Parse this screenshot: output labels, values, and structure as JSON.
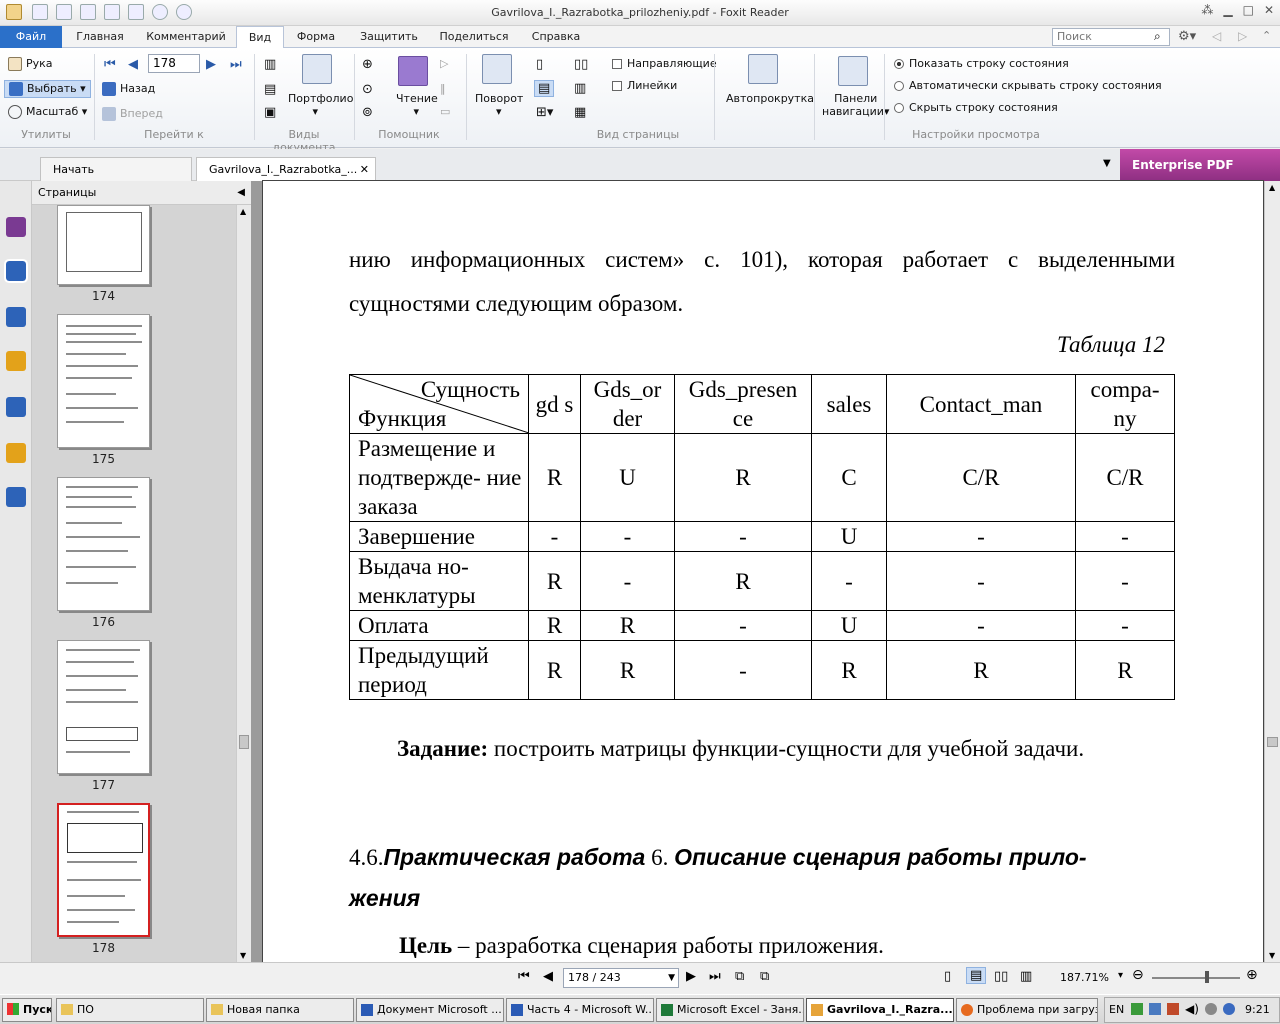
{
  "window": {
    "title": "Gavrilova_I._Razrabotka_prilozheniy.pdf - Foxit Reader"
  },
  "ribbon_tabs": [
    "Файл",
    "Главная",
    "Комментарий",
    "Вид",
    "Форма",
    "Защитить",
    "Поделиться",
    "Справка"
  ],
  "search": {
    "placeholder": "Поиск"
  },
  "ribbon": {
    "tools": {
      "hand": "Рука",
      "select": "Выбрать",
      "zoom": "Масштаб",
      "group": "Утилиты"
    },
    "goto": {
      "page_value": "178",
      "back": "Назад",
      "forward": "Вперед",
      "group": "Перейти к"
    },
    "docviews": {
      "portfolio": "Портфолио",
      "group": "Виды документа"
    },
    "assistant": {
      "reading": "Чтение",
      "group": "Помощник"
    },
    "rotate": {
      "label": "Поворот"
    },
    "pageview": {
      "guides": "Направляющие",
      "rulers": "Линейки",
      "group": "Вид страницы"
    },
    "autoscroll": {
      "label": "Автопрокрутка"
    },
    "navpanels": {
      "label_line1": "Панели",
      "label_line2": "навигации"
    },
    "viewsettings": {
      "opt1": "Показать строку состояния",
      "opt2": "Автоматически скрывать строку состояния",
      "opt3": "Скрыть строку состояния",
      "group": "Настройки просмотра"
    }
  },
  "doc_tabs": {
    "start": "Начать",
    "current": "Gavrilova_I._Razrabotka_...",
    "promo": "Enterprise PDF Reader"
  },
  "pages_panel": {
    "title": "Страницы",
    "thumbs": [
      "174",
      "175",
      "176",
      "177",
      "178"
    ]
  },
  "document": {
    "line1": "нию информационных систем» с. 101), которая работает с выделенными",
    "line2": "сущностями следующим образом.",
    "table_caption": "Таблица 12",
    "table": {
      "header_entity": "Сущность",
      "header_function": "Функция",
      "columns": [
        "gd s",
        "Gds_or der",
        "Gds_presen ce",
        "sales",
        "Contact_man",
        "compa- ny"
      ],
      "rows": [
        {
          "name": "Размещение и подтвержде- ние заказа",
          "cells": [
            "R",
            "U",
            "R",
            "C",
            "C/R",
            "C/R"
          ]
        },
        {
          "name": "Завершение",
          "cells": [
            "-",
            "-",
            "-",
            "U",
            "-",
            "-"
          ]
        },
        {
          "name": "Выдача но- менклатуры",
          "cells": [
            "R",
            "-",
            "R",
            "-",
            "-",
            "-"
          ]
        },
        {
          "name": "Оплата",
          "cells": [
            "R",
            "R",
            "-",
            "U",
            "-",
            "-"
          ]
        },
        {
          "name": "Предыдущий период",
          "cells": [
            "R",
            "R",
            "-",
            "R",
            "R",
            "R"
          ]
        }
      ]
    },
    "task_label": "Задание:",
    "task_text": " построить матрицы функции-сущности для учебной задачи.",
    "section_num": "4.6.",
    "section_part1": "Практическая работа",
    "section_num2": " 6. ",
    "section_part2": "Описание сценария работы прило-",
    "section_part3": "жения",
    "goal_label": "Цель",
    "goal_text": " – разработка сценария работы приложения."
  },
  "statusbar": {
    "page_count": "178 / 243",
    "zoom": "187.71%"
  },
  "taskbar": {
    "start": "Пуск",
    "items": [
      "ПО",
      "Новая папка",
      "Документ Microsoft ...",
      "Часть 4 - Microsoft W...",
      "Microsoft Excel - Заня...",
      "Gavrilova_I._Razra...",
      "Проблема при загруз..."
    ],
    "lang": "EN",
    "clock": "9:21"
  }
}
